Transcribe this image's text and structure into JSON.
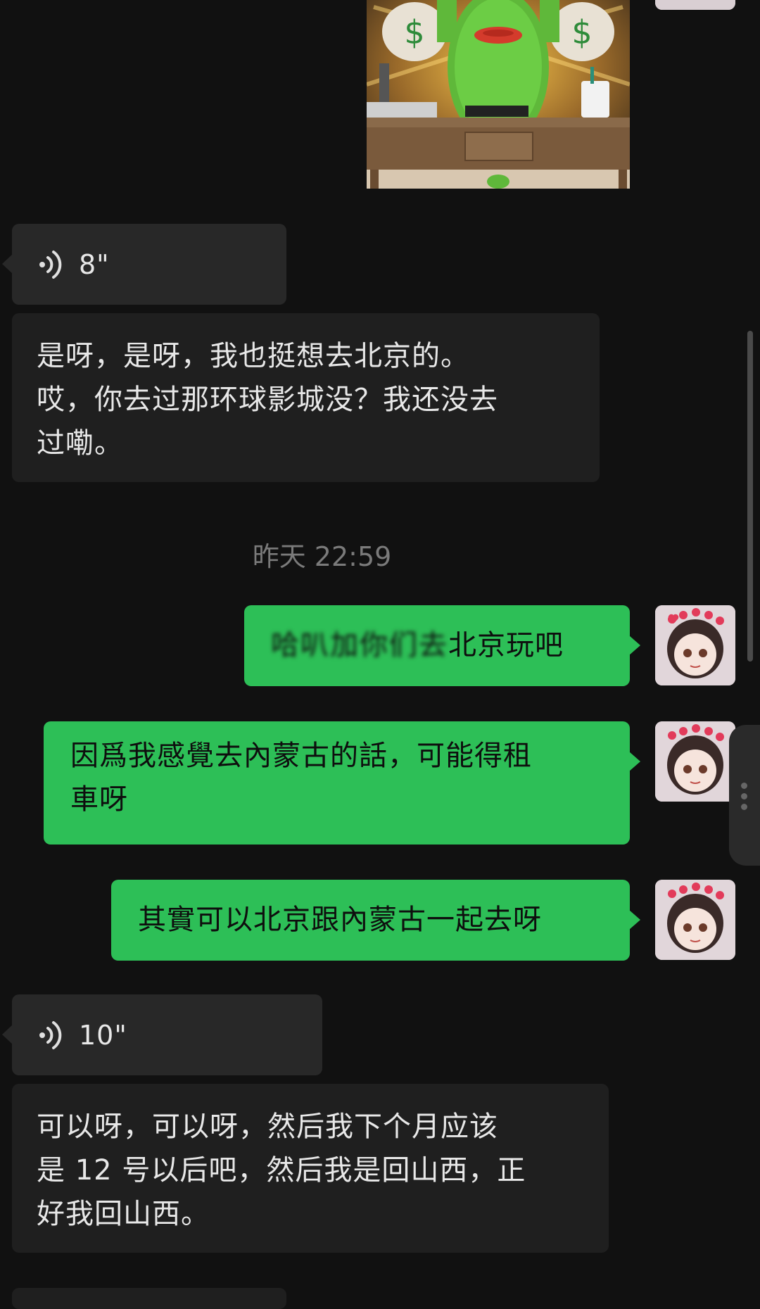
{
  "chat": {
    "timestamp": "昨天 22:59",
    "messages": [
      {
        "type": "voice",
        "side": "in",
        "duration": "8\""
      },
      {
        "type": "text",
        "side": "in",
        "lines": [
          "是呀，是呀，我也挺想去北京的。",
          "哎，你去过那环球影城没？我还没去",
          "过嘞。"
        ]
      },
      {
        "type": "text",
        "side": "out",
        "prefix_blurred": "哈叭加你们去",
        "text": "北京玩吧"
      },
      {
        "type": "text",
        "side": "out",
        "lines": [
          "因爲我感覺去內蒙古的話，可能得租",
          "車呀"
        ]
      },
      {
        "type": "text",
        "side": "out",
        "lines": [
          "其實可以北京跟內蒙古一起去呀"
        ]
      },
      {
        "type": "voice",
        "side": "in",
        "duration": "10\""
      },
      {
        "type": "text",
        "side": "in",
        "lines": [
          "可以呀，可以呀，然后我下个月应该",
          "是 12 号以后吧，然后我是回山西，正",
          "好我回山西。"
        ]
      }
    ]
  },
  "icons": {
    "voice": "voice-wave-icon",
    "avatar": "anime-girl-avatar",
    "sticker": "green-money-bag-sticker"
  },
  "colors": {
    "background": "#111111",
    "incoming_bubble": "#1f1f1f",
    "voice_bubble": "#282828",
    "outgoing_bubble": "#2dbf57",
    "timestamp": "#7a7a7a"
  }
}
